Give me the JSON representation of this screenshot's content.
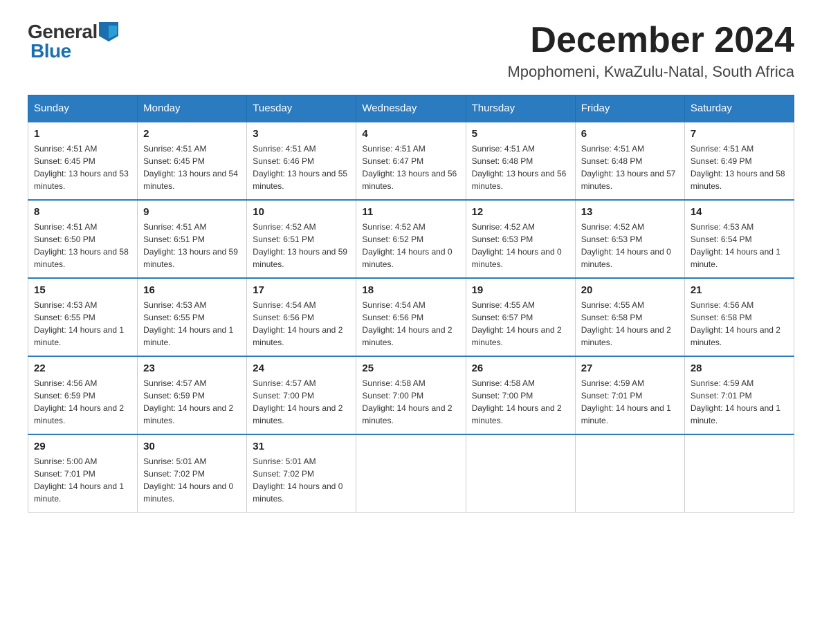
{
  "header": {
    "logo_general": "General",
    "logo_blue": "Blue",
    "month_title": "December 2024",
    "location": "Mpophomeni, KwaZulu-Natal, South Africa"
  },
  "days_of_week": [
    "Sunday",
    "Monday",
    "Tuesday",
    "Wednesday",
    "Thursday",
    "Friday",
    "Saturday"
  ],
  "weeks": [
    [
      {
        "day": "1",
        "sunrise": "4:51 AM",
        "sunset": "6:45 PM",
        "daylight": "13 hours and 53 minutes."
      },
      {
        "day": "2",
        "sunrise": "4:51 AM",
        "sunset": "6:45 PM",
        "daylight": "13 hours and 54 minutes."
      },
      {
        "day": "3",
        "sunrise": "4:51 AM",
        "sunset": "6:46 PM",
        "daylight": "13 hours and 55 minutes."
      },
      {
        "day": "4",
        "sunrise": "4:51 AM",
        "sunset": "6:47 PM",
        "daylight": "13 hours and 56 minutes."
      },
      {
        "day": "5",
        "sunrise": "4:51 AM",
        "sunset": "6:48 PM",
        "daylight": "13 hours and 56 minutes."
      },
      {
        "day": "6",
        "sunrise": "4:51 AM",
        "sunset": "6:48 PM",
        "daylight": "13 hours and 57 minutes."
      },
      {
        "day": "7",
        "sunrise": "4:51 AM",
        "sunset": "6:49 PM",
        "daylight": "13 hours and 58 minutes."
      }
    ],
    [
      {
        "day": "8",
        "sunrise": "4:51 AM",
        "sunset": "6:50 PM",
        "daylight": "13 hours and 58 minutes."
      },
      {
        "day": "9",
        "sunrise": "4:51 AM",
        "sunset": "6:51 PM",
        "daylight": "13 hours and 59 minutes."
      },
      {
        "day": "10",
        "sunrise": "4:52 AM",
        "sunset": "6:51 PM",
        "daylight": "13 hours and 59 minutes."
      },
      {
        "day": "11",
        "sunrise": "4:52 AM",
        "sunset": "6:52 PM",
        "daylight": "14 hours and 0 minutes."
      },
      {
        "day": "12",
        "sunrise": "4:52 AM",
        "sunset": "6:53 PM",
        "daylight": "14 hours and 0 minutes."
      },
      {
        "day": "13",
        "sunrise": "4:52 AM",
        "sunset": "6:53 PM",
        "daylight": "14 hours and 0 minutes."
      },
      {
        "day": "14",
        "sunrise": "4:53 AM",
        "sunset": "6:54 PM",
        "daylight": "14 hours and 1 minute."
      }
    ],
    [
      {
        "day": "15",
        "sunrise": "4:53 AM",
        "sunset": "6:55 PM",
        "daylight": "14 hours and 1 minute."
      },
      {
        "day": "16",
        "sunrise": "4:53 AM",
        "sunset": "6:55 PM",
        "daylight": "14 hours and 1 minute."
      },
      {
        "day": "17",
        "sunrise": "4:54 AM",
        "sunset": "6:56 PM",
        "daylight": "14 hours and 2 minutes."
      },
      {
        "day": "18",
        "sunrise": "4:54 AM",
        "sunset": "6:56 PM",
        "daylight": "14 hours and 2 minutes."
      },
      {
        "day": "19",
        "sunrise": "4:55 AM",
        "sunset": "6:57 PM",
        "daylight": "14 hours and 2 minutes."
      },
      {
        "day": "20",
        "sunrise": "4:55 AM",
        "sunset": "6:58 PM",
        "daylight": "14 hours and 2 minutes."
      },
      {
        "day": "21",
        "sunrise": "4:56 AM",
        "sunset": "6:58 PM",
        "daylight": "14 hours and 2 minutes."
      }
    ],
    [
      {
        "day": "22",
        "sunrise": "4:56 AM",
        "sunset": "6:59 PM",
        "daylight": "14 hours and 2 minutes."
      },
      {
        "day": "23",
        "sunrise": "4:57 AM",
        "sunset": "6:59 PM",
        "daylight": "14 hours and 2 minutes."
      },
      {
        "day": "24",
        "sunrise": "4:57 AM",
        "sunset": "7:00 PM",
        "daylight": "14 hours and 2 minutes."
      },
      {
        "day": "25",
        "sunrise": "4:58 AM",
        "sunset": "7:00 PM",
        "daylight": "14 hours and 2 minutes."
      },
      {
        "day": "26",
        "sunrise": "4:58 AM",
        "sunset": "7:00 PM",
        "daylight": "14 hours and 2 minutes."
      },
      {
        "day": "27",
        "sunrise": "4:59 AM",
        "sunset": "7:01 PM",
        "daylight": "14 hours and 1 minute."
      },
      {
        "day": "28",
        "sunrise": "4:59 AM",
        "sunset": "7:01 PM",
        "daylight": "14 hours and 1 minute."
      }
    ],
    [
      {
        "day": "29",
        "sunrise": "5:00 AM",
        "sunset": "7:01 PM",
        "daylight": "14 hours and 1 minute."
      },
      {
        "day": "30",
        "sunrise": "5:01 AM",
        "sunset": "7:02 PM",
        "daylight": "14 hours and 0 minutes."
      },
      {
        "day": "31",
        "sunrise": "5:01 AM",
        "sunset": "7:02 PM",
        "daylight": "14 hours and 0 minutes."
      },
      null,
      null,
      null,
      null
    ]
  ]
}
